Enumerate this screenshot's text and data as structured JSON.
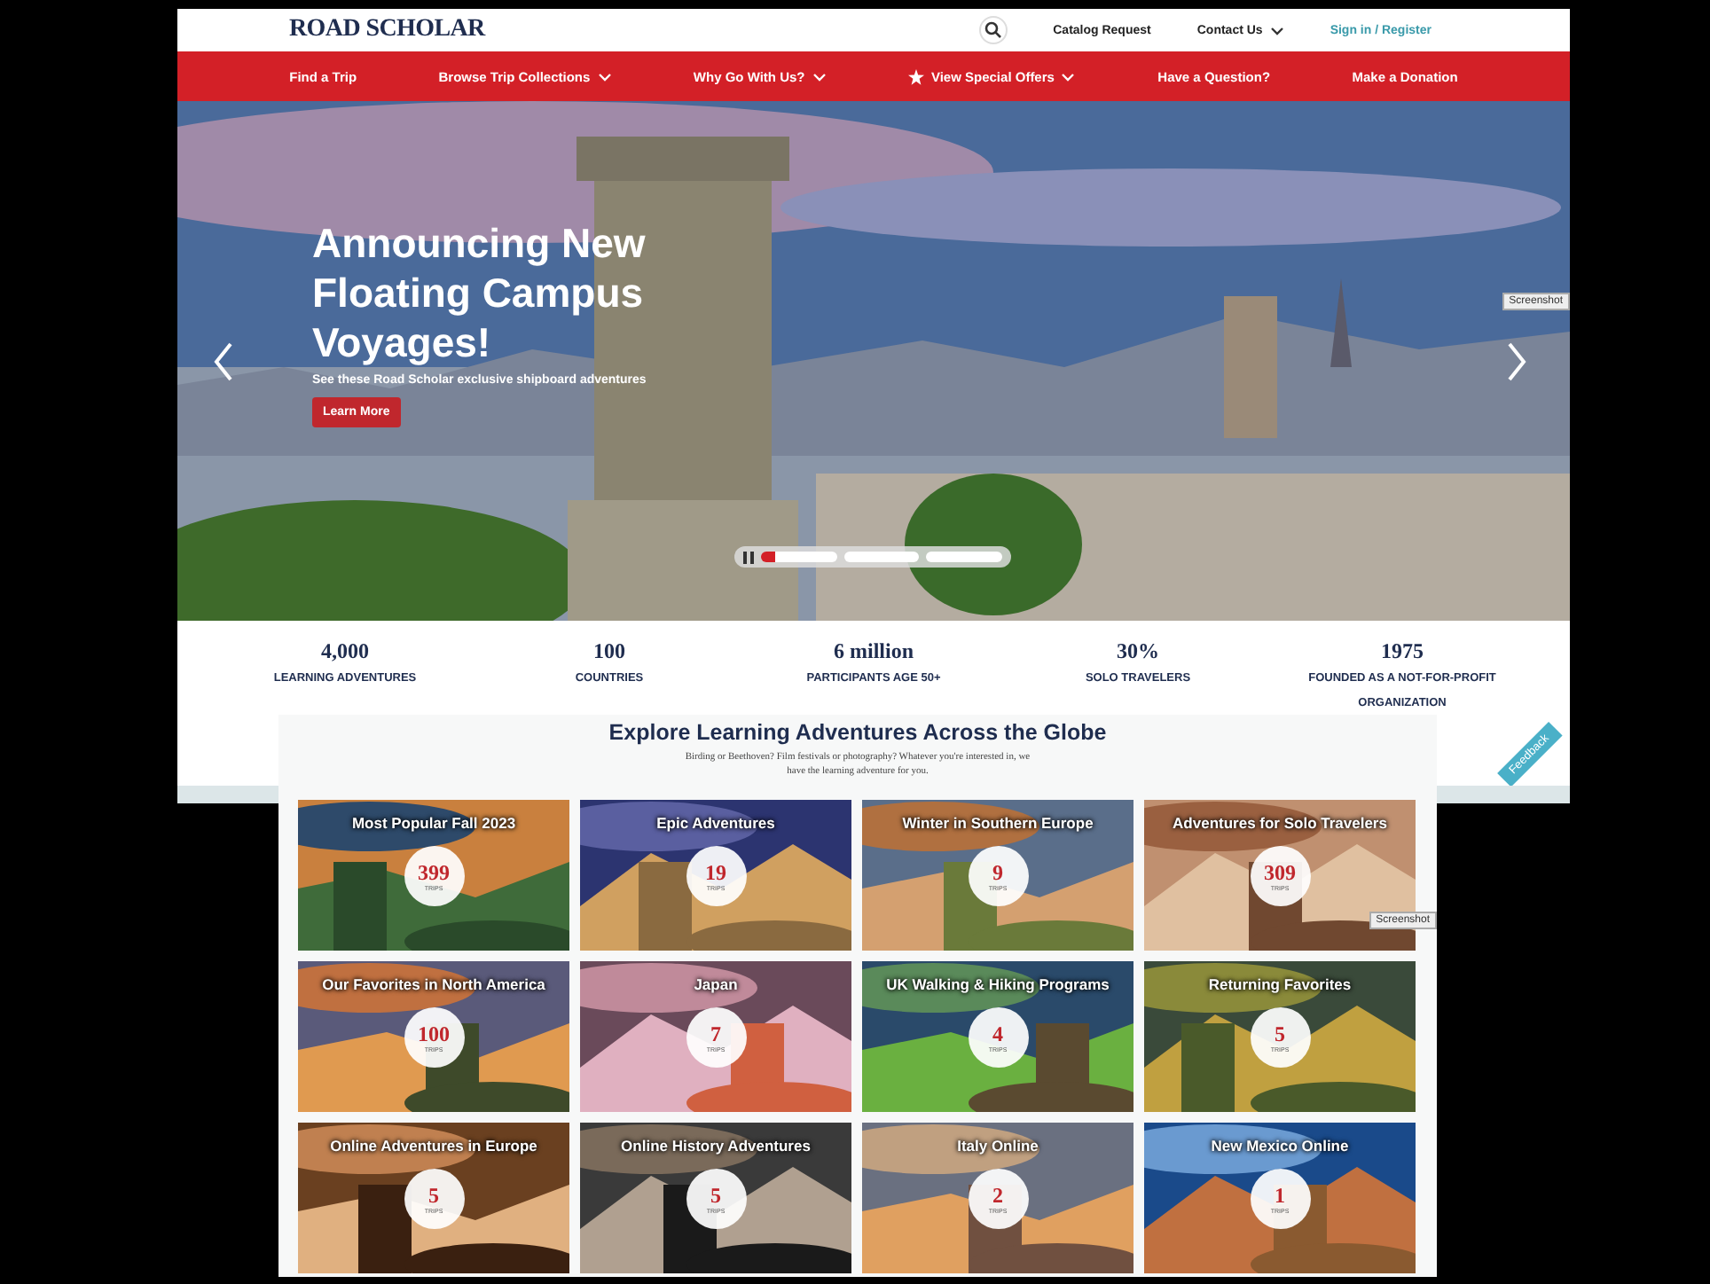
{
  "header": {
    "logo": "ROAD SCHOLAR",
    "links": [
      {
        "label": "Catalog Request",
        "caret": false,
        "kind": "link"
      },
      {
        "label": "Contact Us",
        "caret": true,
        "kind": "link"
      },
      {
        "label": "Sign in / Register",
        "caret": false,
        "kind": "account"
      }
    ]
  },
  "nav": [
    {
      "label": "Find a Trip",
      "caret": false,
      "star": false
    },
    {
      "label": "Browse Trip Collections",
      "caret": true,
      "star": false
    },
    {
      "label": "Why Go With Us?",
      "caret": true,
      "star": false
    },
    {
      "label": "View Special Offers",
      "caret": true,
      "star": true
    },
    {
      "label": "Have a Question?",
      "caret": false,
      "star": false
    },
    {
      "label": "Make a Donation",
      "caret": false,
      "star": false
    }
  ],
  "hero": {
    "kind": "picture",
    "headline": "Announcing New Floating Campus Voyages!",
    "subtitle": "See these Road Scholar exclusive shipboard adventures",
    "button": "Learn More",
    "slides": [
      {
        "selected": true
      },
      {
        "selected": false
      },
      {
        "selected": false
      }
    ],
    "tag": "Screenshot"
  },
  "stats": [
    {
      "value": "4,000",
      "label": "LEARNING ADVENTURES"
    },
    {
      "value": "100",
      "label": "COUNTRIES"
    },
    {
      "value": "6 million",
      "label": "PARTICIPANTS AGE 50+"
    },
    {
      "value": "30%",
      "label": "SOLO TRAVELERS"
    },
    {
      "value": "1975",
      "label": "FOUNDED AS A NOT-FOR-PROFIT ORGANIZATION"
    }
  ],
  "feedback": "Feedback",
  "explore": {
    "title": "Explore Learning Adventures Across the Globe",
    "subtitle": "Birding or Beethoven? Film festivals or photography? Whatever you're interested in, we have the learning adventure for you.",
    "tag": "Screenshot",
    "tiles": [
      {
        "title": "Most Popular Fall 2023",
        "count": "399",
        "unit": "TRIPS"
      },
      {
        "title": "Epic Adventures",
        "count": "19",
        "unit": "TRIPS"
      },
      {
        "title": "Winter in Southern Europe",
        "count": "9",
        "unit": "TRIPS"
      },
      {
        "title": "Adventures for Solo Travelers",
        "count": "309",
        "unit": "TRIPS"
      },
      {
        "title": "Our Favorites in North America",
        "count": "100",
        "unit": "TRIPS"
      },
      {
        "title": "Japan",
        "count": "7",
        "unit": "TRIPS"
      },
      {
        "title": "UK Walking & Hiking Programs",
        "count": "4",
        "unit": "TRIPS"
      },
      {
        "title": "Returning Favorites",
        "count": "5",
        "unit": "TRIPS"
      },
      {
        "title": "Online Adventures in Europe",
        "count": "5",
        "unit": "TRIPS"
      },
      {
        "title": "Online History Adventures",
        "count": "5",
        "unit": "TRIPS"
      },
      {
        "title": "Italy Online",
        "count": "2",
        "unit": "TRIPS"
      },
      {
        "title": "New Mexico Online",
        "count": "1",
        "unit": "TRIPS"
      }
    ]
  }
}
